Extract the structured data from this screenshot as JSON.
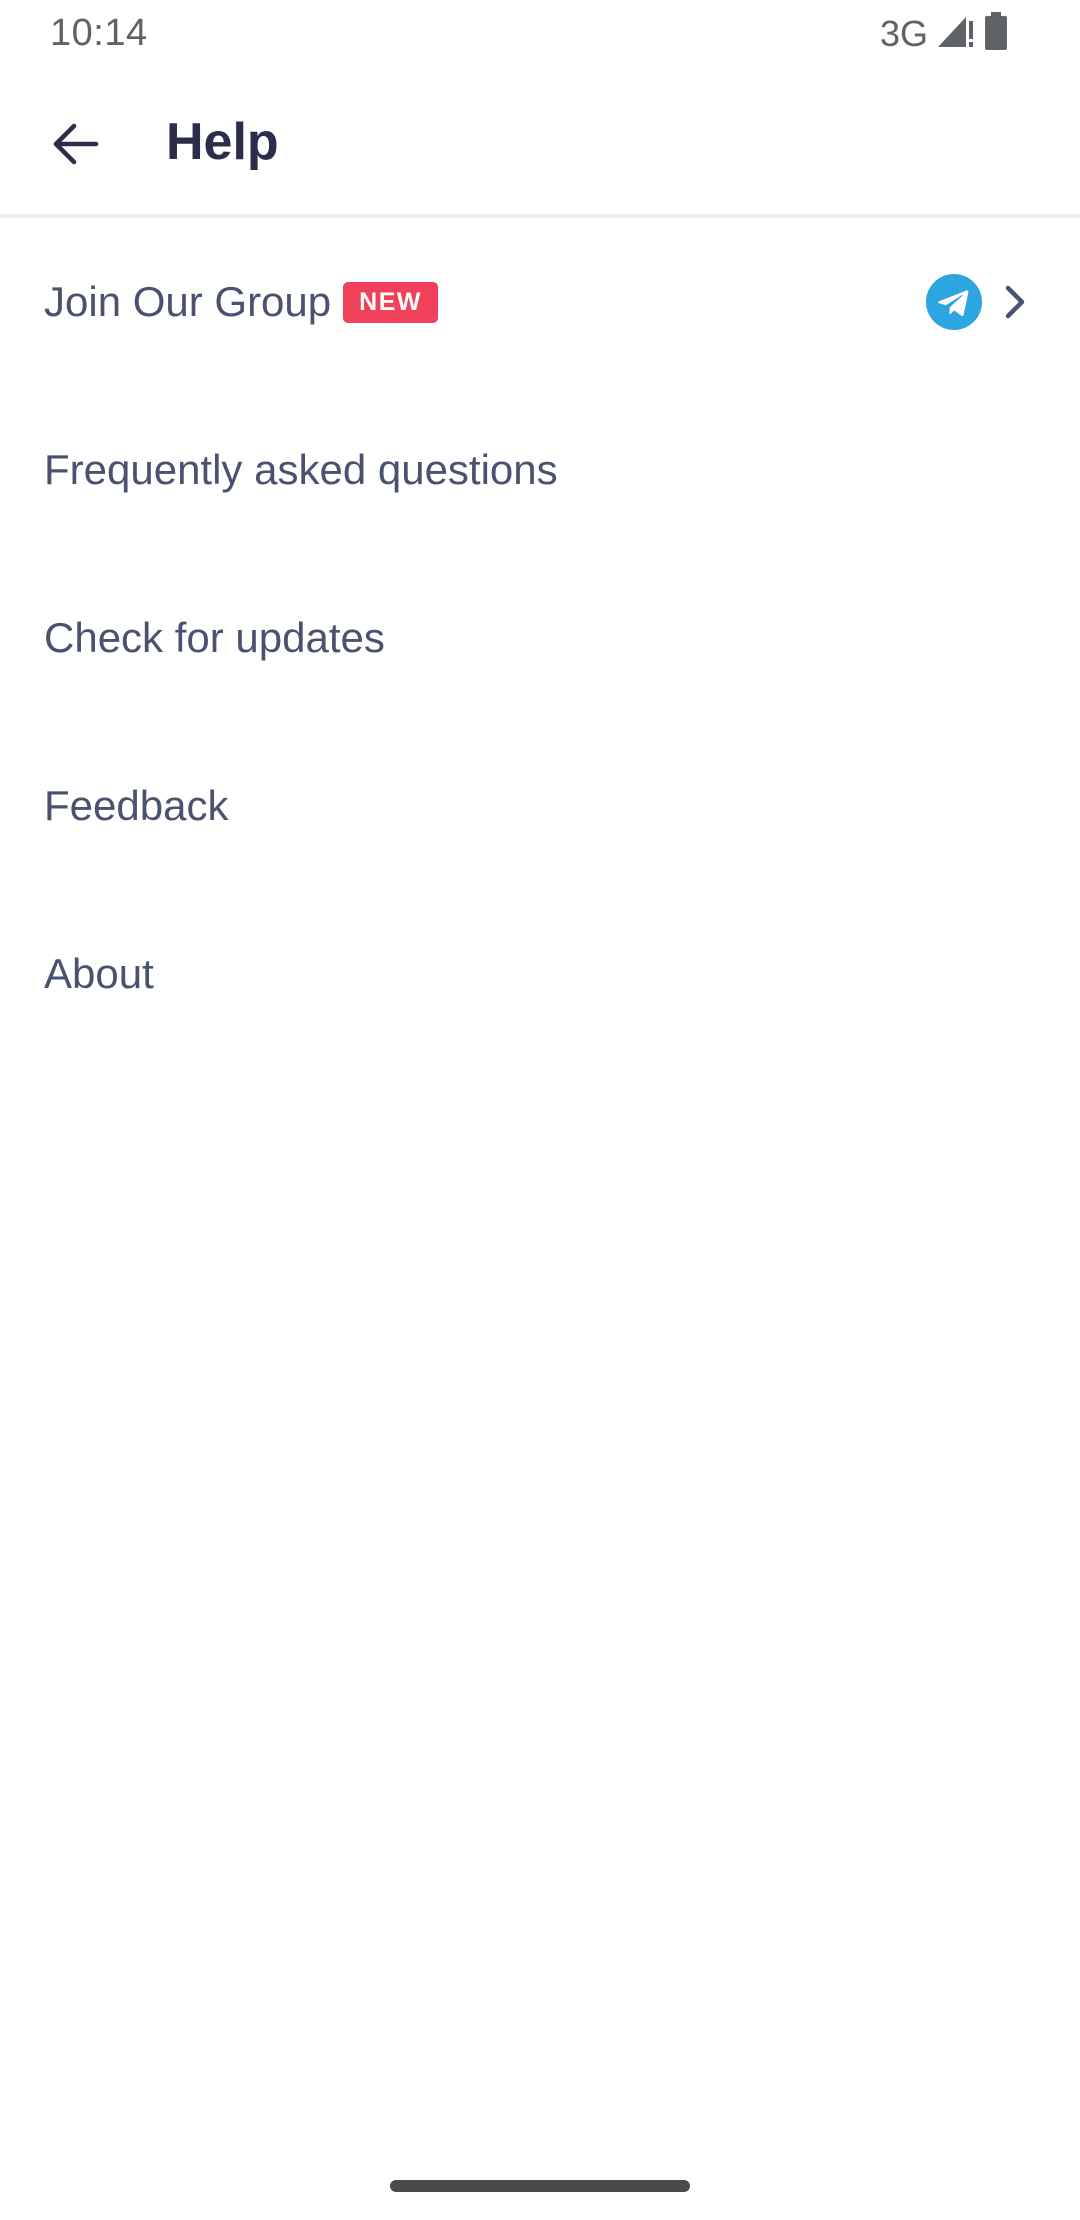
{
  "status_bar": {
    "time": "10:14",
    "network": "3G",
    "icons": [
      "signal-icon",
      "battery-icon"
    ]
  },
  "app_bar": {
    "title": "Help",
    "back_icon": "arrow-left-icon"
  },
  "menu": {
    "items": [
      {
        "label": "Join Our Group",
        "badge": "NEW",
        "icon": "telegram-icon",
        "trailing": "chevron-right-icon"
      },
      {
        "label": "Frequently asked questions"
      },
      {
        "label": "Check for updates"
      },
      {
        "label": "Feedback"
      },
      {
        "label": "About"
      }
    ]
  },
  "colors": {
    "title": "#2b2d4a",
    "item_text": "#4b5270",
    "badge_bg": "#f0405a",
    "telegram": "#2ca5e0",
    "divider": "#eeeff3"
  }
}
